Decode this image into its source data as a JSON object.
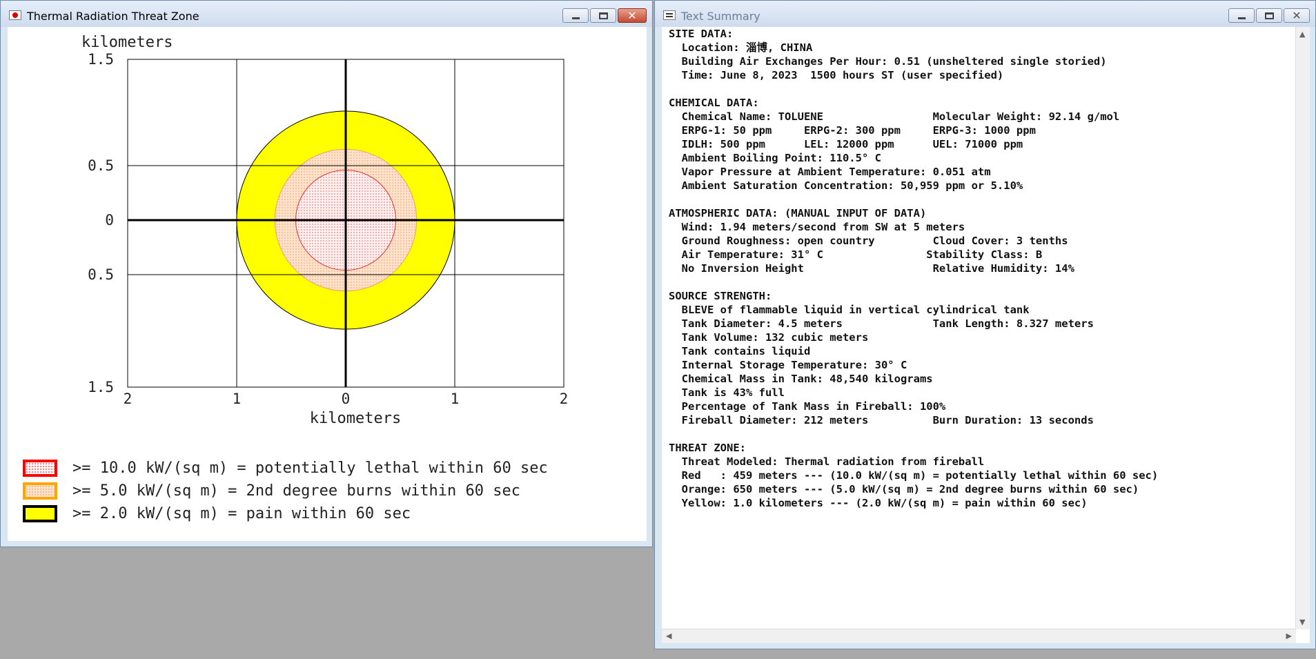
{
  "threat_window": {
    "title": "Thermal Radiation Threat Zone",
    "chart": {
      "y_title": "kilometers",
      "x_title": "kilometers",
      "y_ticks": [
        "1.5",
        "0.5",
        "0",
        "0.5",
        "1.5"
      ],
      "x_ticks": [
        "2",
        "1",
        "0",
        "1",
        "2"
      ]
    },
    "legend": [
      {
        "text": ">= 10.0 kW/(sq m) = potentially lethal within 60 sec",
        "color": "#ff0000"
      },
      {
        "text": ">= 5.0 kW/(sq m) = 2nd degree burns within 60 sec",
        "color": "#ffa500"
      },
      {
        "text": ">= 2.0 kW/(sq m) = pain within 60 sec",
        "color": "#ffff00"
      }
    ]
  },
  "chart_data": {
    "type": "threat-zone-map",
    "xlabel": "kilometers",
    "ylabel": "kilometers",
    "xlim": [
      -2,
      2
    ],
    "ylim": [
      -1.5,
      1.5
    ],
    "grid": true,
    "zones": [
      {
        "name": ">= 2.0 kW/(sq m) = pain within 60 sec",
        "radius_km": 1.0,
        "color": "#ffff00"
      },
      {
        "name": ">= 5.0 kW/(sq m) = 2nd degree burns within 60 sec",
        "radius_km": 0.65,
        "color": "#ffa500"
      },
      {
        "name": ">= 10.0 kW/(sq m) = potentially lethal within 60 sec",
        "radius_km": 0.459,
        "color": "#ff0000"
      }
    ]
  },
  "summary_window": {
    "title": "Text Summary",
    "lines": [
      "SITE DATA:",
      "  Location: 淄博, CHINA",
      "  Building Air Exchanges Per Hour: 0.51 (unsheltered single storied)",
      "  Time: June 8, 2023  1500 hours ST (user specified)",
      "",
      "CHEMICAL DATA:",
      "  Chemical Name: TOLUENE                 Molecular Weight: 92.14 g/mol",
      "  ERPG-1: 50 ppm     ERPG-2: 300 ppm     ERPG-3: 1000 ppm",
      "  IDLH: 500 ppm      LEL: 12000 ppm      UEL: 71000 ppm",
      "  Ambient Boiling Point: 110.5° C",
      "  Vapor Pressure at Ambient Temperature: 0.051 atm",
      "  Ambient Saturation Concentration: 50,959 ppm or 5.10%",
      "",
      "ATMOSPHERIC DATA: (MANUAL INPUT OF DATA)",
      "  Wind: 1.94 meters/second from SW at 5 meters",
      "  Ground Roughness: open country         Cloud Cover: 3 tenths",
      "  Air Temperature: 31° C                Stability Class: B",
      "  No Inversion Height                    Relative Humidity: 14%",
      "",
      "SOURCE STRENGTH:",
      "  BLEVE of flammable liquid in vertical cylindrical tank",
      "  Tank Diameter: 4.5 meters              Tank Length: 8.327 meters",
      "  Tank Volume: 132 cubic meters",
      "  Tank contains liquid",
      "  Internal Storage Temperature: 30° C",
      "  Chemical Mass in Tank: 48,540 kilograms",
      "  Tank is 43% full",
      "  Percentage of Tank Mass in Fireball: 100%",
      "  Fireball Diameter: 212 meters          Burn Duration: 13 seconds",
      "",
      "THREAT ZONE:",
      "  Threat Modeled: Thermal radiation from fireball",
      "  Red   : 459 meters --- (10.0 kW/(sq m) = potentially lethal within 60 sec)",
      "  Orange: 650 meters --- (5.0 kW/(sq m) = 2nd degree burns within 60 sec)",
      "  Yellow: 1.0 kilometers --- (2.0 kW/(sq m) = pain within 60 sec)"
    ]
  }
}
